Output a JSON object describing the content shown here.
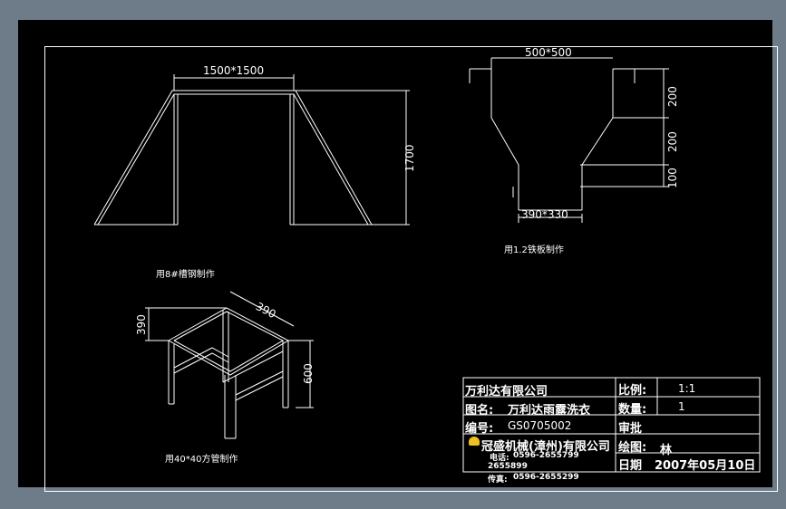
{
  "drawing": {
    "frame_dims": {
      "top_width": "1500*1500",
      "height": "1700",
      "note": "用8#槽钢制作"
    },
    "hopper_dims": {
      "top_width": "500*500",
      "seg1": "200",
      "seg2": "200",
      "seg3": "100",
      "bottom_width": "390*330",
      "note": "用1.2铁板制作"
    },
    "stand_dims": {
      "width": "390",
      "depth": "390",
      "height": "600",
      "note": "用40*40方管制作"
    }
  },
  "title_block": {
    "company": "万利达有限公司",
    "drawing_name_label": "图名:",
    "drawing_name": "万利达雨露洗衣",
    "number_label": "编号:",
    "number": "GS0705002",
    "maker": "冠盛机械(漳州)有限公司",
    "phone_label": "电话:",
    "phone1": "0596-2655799",
    "phone2": "2655899",
    "fax_label": "传真:",
    "fax": "0596-2655299",
    "scale_label": "比例:",
    "scale": "1:1",
    "quantity_label": "数量:",
    "quantity": "1",
    "approve_label": "审批",
    "drawn_label": "绘图:",
    "drawn_by": "林",
    "date_label": "日期",
    "date": "2007年05月10日"
  },
  "colors": {
    "background": "#000000",
    "lines": "#ffffff",
    "outer": "#6e7c8a",
    "logo": "#f0c020"
  }
}
